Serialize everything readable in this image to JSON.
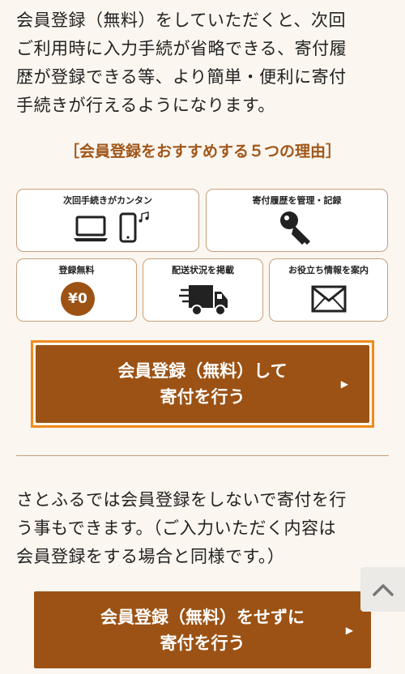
{
  "intro": {
    "lines": [
      "会員登録（無料）をしていただくと、次回",
      "ご利用時に入力手続が省略できる、寄付履",
      "歴が登録できる等、より簡単・便利に寄付",
      "手続きが行えるようになります。"
    ]
  },
  "reasons": {
    "title": "［会員登録をおすすめする５つの理由］",
    "items": [
      {
        "label": "次回手続きがカンタン",
        "icon": "laptop-phone-icon"
      },
      {
        "label": "寄付履歴を管理・記録",
        "icon": "key-icon"
      },
      {
        "label": "登録無料",
        "icon": "yen-zero-icon",
        "icon_text": "¥0"
      },
      {
        "label": "配送状況を掲載",
        "icon": "delivery-truck-icon"
      },
      {
        "label": "お役立ち情報を案内",
        "icon": "mail-icon"
      }
    ]
  },
  "register_button": {
    "line1": "会員登録（無料）して",
    "line2": "寄付を行う",
    "arrow": "▶"
  },
  "note": {
    "lines": [
      "さとふるでは会員登録をしないで寄付を行",
      "う事もできます。（ご入力いただく内容は",
      "会員登録をする場合と同様です。）"
    ]
  },
  "guest_button": {
    "line1": "会員登録（無料）をせずに",
    "line2": "寄付を行う",
    "arrow": "▶"
  },
  "colors": {
    "brand_brown": "#9c5214",
    "accent_orange": "#f08a1c",
    "title_brown": "#a0561a",
    "background": "#fbf6ef"
  }
}
